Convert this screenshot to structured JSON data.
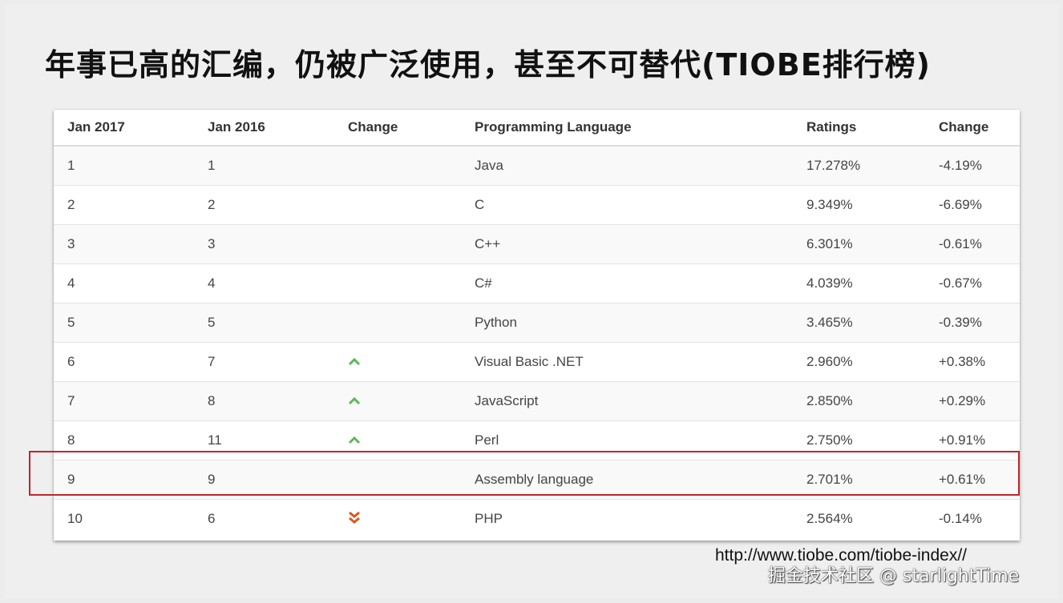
{
  "title": "年事已高的汇编，仍被广泛使用，甚至不可替代(TIOBE排行榜)",
  "table": {
    "headers": [
      "Jan 2017",
      "Jan 2016",
      "Change",
      "Programming Language",
      "Ratings",
      "Change"
    ],
    "rows": [
      {
        "jan2017": "1",
        "jan2016": "1",
        "trend": "none",
        "language": "Java",
        "rating": "17.278%",
        "change": "-4.19%"
      },
      {
        "jan2017": "2",
        "jan2016": "2",
        "trend": "none",
        "language": "C",
        "rating": "9.349%",
        "change": "-6.69%"
      },
      {
        "jan2017": "3",
        "jan2016": "3",
        "trend": "none",
        "language": "C++",
        "rating": "6.301%",
        "change": "-0.61%"
      },
      {
        "jan2017": "4",
        "jan2016": "4",
        "trend": "none",
        "language": "C#",
        "rating": "4.039%",
        "change": "-0.67%"
      },
      {
        "jan2017": "5",
        "jan2016": "5",
        "trend": "none",
        "language": "Python",
        "rating": "3.465%",
        "change": "-0.39%"
      },
      {
        "jan2017": "6",
        "jan2016": "7",
        "trend": "up",
        "language": "Visual Basic .NET",
        "rating": "2.960%",
        "change": "+0.38%"
      },
      {
        "jan2017": "7",
        "jan2016": "8",
        "trend": "up",
        "language": "JavaScript",
        "rating": "2.850%",
        "change": "+0.29%"
      },
      {
        "jan2017": "8",
        "jan2016": "11",
        "trend": "up",
        "language": "Perl",
        "rating": "2.750%",
        "change": "+0.91%"
      },
      {
        "jan2017": "9",
        "jan2016": "9",
        "trend": "none",
        "language": "Assembly language",
        "rating": "2.701%",
        "change": "+0.61%"
      },
      {
        "jan2017": "10",
        "jan2016": "6",
        "trend": "down-double",
        "language": "PHP",
        "rating": "2.564%",
        "change": "-0.14%"
      }
    ],
    "highlighted_row": "Assembly language"
  },
  "source_url": "http://www.tiobe.com/tiobe-index//",
  "watermark": "掘金技术社区 @ starlightTime",
  "colors": {
    "up_arrow": "#5cb85c",
    "down_arrow": "#e2541f",
    "highlight_border": "#c0252a"
  }
}
